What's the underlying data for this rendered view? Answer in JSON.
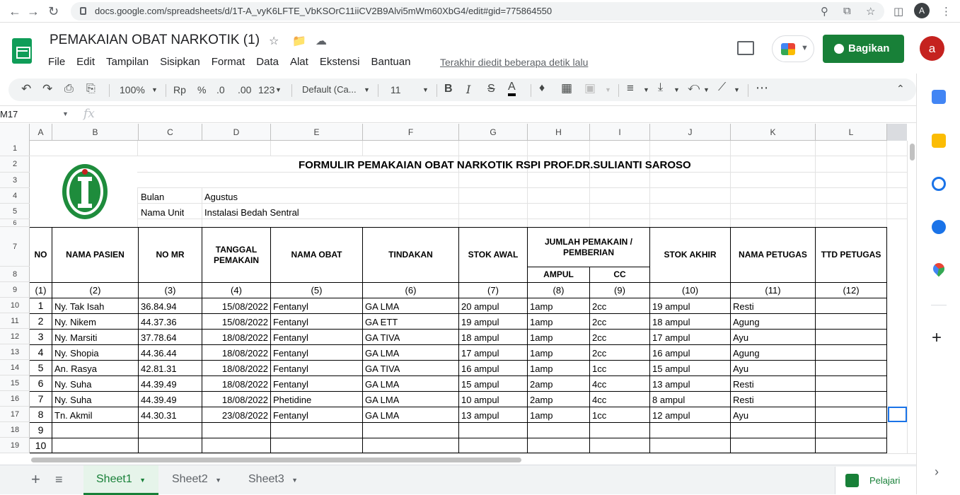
{
  "browser": {
    "url": "docs.google.com/spreadsheets/d/1T-A_vyK6LFTE_VbKSOrC11iiCV2B9Alvi5mWm60XbG4/edit#gid=775864550",
    "profile_initial": "A"
  },
  "app": {
    "title": "PEMAKAIAN OBAT NARKOTIK (1)",
    "menu": [
      "File",
      "Edit",
      "Tampilan",
      "Sisipkan",
      "Format",
      "Data",
      "Alat",
      "Ekstensi",
      "Bantuan"
    ],
    "last_edit": "Terakhir diedit beberapa detik lalu",
    "share_label": "Bagikan",
    "avatar_initial": "a"
  },
  "toolbar": {
    "zoom": "100%",
    "currency": "Rp",
    "percent": "%",
    "dec_decrease": ".0",
    "dec_increase": ".00",
    "number_format": "123",
    "font": "Default (Ca...",
    "font_size": "11",
    "bold": "B",
    "italic": "I",
    "strike": "S",
    "text_color": "A",
    "more": "⋯"
  },
  "formula_bar": {
    "cell_ref": "M17",
    "fx": "fx",
    "value": ""
  },
  "columns": [
    "A",
    "B",
    "C",
    "D",
    "E",
    "F",
    "G",
    "H",
    "I",
    "J",
    "K",
    "L"
  ],
  "rows": [
    "1",
    "2",
    "3",
    "4",
    "5",
    "6",
    "7",
    "8",
    "9",
    "10",
    "11",
    "12",
    "13",
    "14",
    "15",
    "16",
    "17",
    "18",
    "19"
  ],
  "sheet": {
    "form_title": "FORMULIR PEMAKAIAN OBAT NARKOTIK RSPI PROF.DR.SULIANTI SAROSO",
    "bulan_label": "Bulan",
    "bulan_value": "Agustus",
    "unit_label": "Nama Unit",
    "unit_value": "Instalasi Bedah Sentral",
    "headers": {
      "no": "NO",
      "nama_pasien": "NAMA PASIEN",
      "no_mr": "NO MR",
      "tanggal": "TANGGAL PEMAKAIN",
      "nama_obat": "NAMA OBAT",
      "tindakan": "TINDAKAN",
      "stok_awal": "STOK AWAL",
      "jumlah": "JUMLAH PEMAKAIN / PEMBERIAN",
      "ampul": "AMPUL",
      "cc": "CC",
      "stok_akhir": "STOK AKHIR",
      "nama_petugas": "NAMA PETUGAS",
      "ttd_petugas": "TTD PETUGAS"
    },
    "col_numbers": [
      "(1)",
      "(2)",
      "(3)",
      "(4)",
      "(5)",
      "(6)",
      "(7)",
      "(8)",
      "(9)",
      "(10)",
      "(11)",
      "(12)"
    ],
    "records": [
      {
        "no": "1",
        "nama": "Ny. Tak Isah",
        "mr": "36.84.94",
        "tgl": "15/08/2022",
        "obat": "Fentanyl",
        "tindakan": "GA LMA",
        "stok_awal": "20 ampul",
        "ampul": "1amp",
        "cc": "2cc",
        "stok_akhir": "19 ampul",
        "petugas": "Resti"
      },
      {
        "no": "2",
        "nama": "Ny. Nikem",
        "mr": "44.37.36",
        "tgl": "15/08/2022",
        "obat": "Fentanyl",
        "tindakan": "GA ETT",
        "stok_awal": "19 ampul",
        "ampul": "1amp",
        "cc": "2cc",
        "stok_akhir": "18 ampul",
        "petugas": "Agung"
      },
      {
        "no": "3",
        "nama": "Ny. Marsiti",
        "mr": "37.78.64",
        "tgl": "18/08/2022",
        "obat": "Fentanyl",
        "tindakan": "GA TIVA",
        "stok_awal": "18 ampul",
        "ampul": "1amp",
        "cc": "2cc",
        "stok_akhir": "17 ampul",
        "petugas": "Ayu"
      },
      {
        "no": "4",
        "nama": "Ny. Shopia",
        "mr": "44.36.44",
        "tgl": "18/08/2022",
        "obat": "Fentanyl",
        "tindakan": "GA LMA",
        "stok_awal": "17 ampul",
        "ampul": "1amp",
        "cc": "2cc",
        "stok_akhir": "16 ampul",
        "petugas": "Agung"
      },
      {
        "no": "5",
        "nama": "An. Rasya",
        "mr": "42.81.31",
        "tgl": "18/08/2022",
        "obat": "Fentanyl",
        "tindakan": "GA TIVA",
        "stok_awal": "16 ampul",
        "ampul": "1amp",
        "cc": "1cc",
        "stok_akhir": "15 ampul",
        "petugas": "Ayu"
      },
      {
        "no": "6",
        "nama": "Ny. Suha",
        "mr": "44.39.49",
        "tgl": "18/08/2022",
        "obat": "Fentanyl",
        "tindakan": "GA LMA",
        "stok_awal": "15 ampul",
        "ampul": "2amp",
        "cc": "4cc",
        "stok_akhir": "13 ampul",
        "petugas": "Resti"
      },
      {
        "no": "7",
        "nama": "Ny. Suha",
        "mr": "44.39.49",
        "tgl": "18/08/2022",
        "obat": "Phetidine",
        "tindakan": "GA LMA",
        "stok_awal": "10 ampul",
        "ampul": "2amp",
        "cc": "4cc",
        "stok_akhir": "8 ampul",
        "petugas": "Resti"
      },
      {
        "no": "8",
        "nama": "Tn. Akmil",
        "mr": "44.30.31",
        "tgl": "23/08/2022",
        "obat": "Fentanyl",
        "tindakan": "GA LMA",
        "stok_awal": "13 ampul",
        "ampul": "1amp",
        "cc": "1cc",
        "stok_akhir": "12 ampul",
        "petugas": "Ayu"
      }
    ],
    "empty_numbers": [
      "9",
      "10"
    ]
  },
  "sheet_tabs": [
    "Sheet1",
    "Sheet2",
    "Sheet3"
  ],
  "explore_label": "Pelajari",
  "sidebar_icons": [
    "calendar-icon",
    "keep-icon",
    "tasks-icon",
    "contacts-icon",
    "maps-icon",
    "add-icon"
  ],
  "colors": {
    "brand_green": "#188038",
    "accent_red": "#c5221f"
  }
}
